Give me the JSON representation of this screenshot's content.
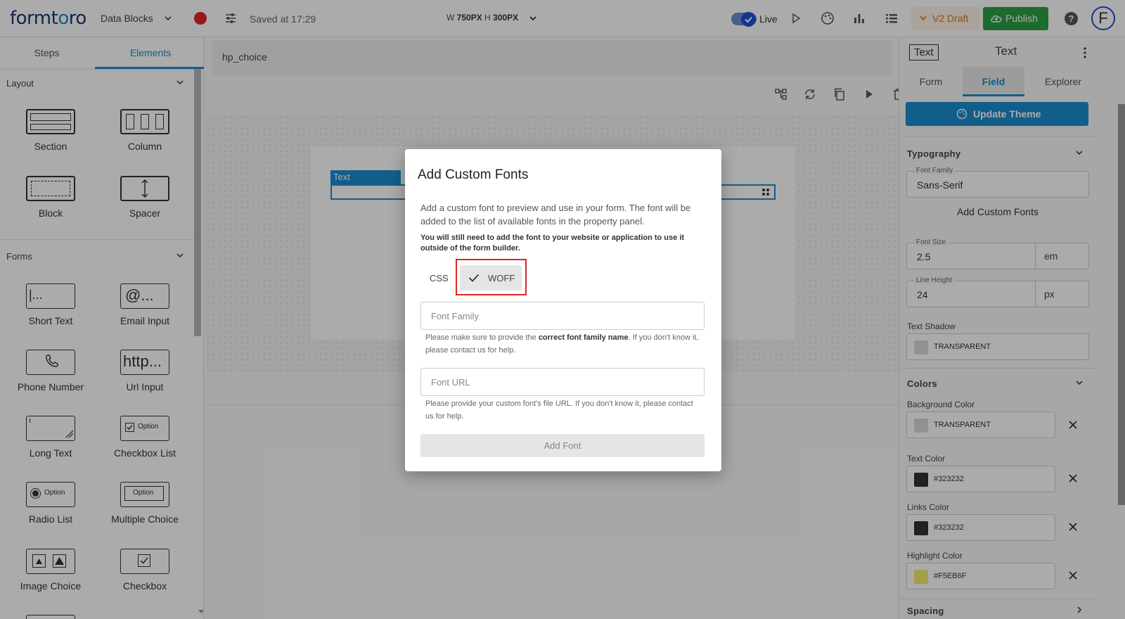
{
  "topbar": {
    "logo_a": "formt",
    "logo_b": "o",
    "logo_c": "ro",
    "project_name": "Data Blocks",
    "saved_text": "Saved at 17:29",
    "dims_w_label": "W",
    "dims_w": "750PX",
    "dims_h_label": "H",
    "dims_h": "300PX",
    "live_label": "Live",
    "draft_label": "V2 Draft",
    "publish_label": "Publish",
    "help_label": "?",
    "avatar_initial": "F"
  },
  "left": {
    "tabs": [
      "Steps",
      "Elements"
    ],
    "layout_title": "Layout",
    "forms_title": "Forms",
    "layout_items": [
      "Section",
      "Column",
      "Block",
      "Spacer"
    ],
    "form_items": [
      "Short Text",
      "Email Input",
      "Phone Number",
      "Url Input",
      "Long Text",
      "Checkbox List",
      "Radio List",
      "Multiple Choice",
      "Image Choice",
      "Checkbox"
    ],
    "icon_short_text": "|...",
    "icon_email": "@...",
    "icon_url": "http...",
    "icon_option": "Option"
  },
  "canvas": {
    "breadcrumb": "hp_choice",
    "text_tag": "Text"
  },
  "right": {
    "tag": "Text",
    "title": "Text",
    "tabs": [
      "Form",
      "Field",
      "Explorer"
    ],
    "update_theme": "Update Theme",
    "typography_title": "Typography",
    "font_family_label": "Font Family",
    "font_family_value": "Sans-Serif",
    "add_custom_fonts": "Add Custom Fonts",
    "font_size_label": "Font Size",
    "font_size_value": "2.5",
    "font_size_unit": "em",
    "line_height_label": "Line Height",
    "line_height_value": "24",
    "line_height_unit": "px",
    "text_shadow_label": "Text Shadow",
    "text_shadow_value": "TRANSPARENT",
    "colors_title": "Colors",
    "bg_color_label": "Background Color",
    "bg_color_value": "TRANSPARENT",
    "text_color_label": "Text Color",
    "text_color_value": "#323232",
    "links_color_label": "Links Color",
    "links_color_value": "#323232",
    "highlight_color_label": "Highlight Color",
    "highlight_color_value": "#F5EB6F",
    "spacing_title": "Spacing"
  },
  "modal": {
    "title": "Add Custom Fonts",
    "description": "Add a custom font to preview and use in your form. The font will be added to the list of available fonts in the property panel.",
    "note": "You will still need to add the font to your website or application to use it outside of the form builder.",
    "option_css": "CSS",
    "option_woff": "WOFF",
    "font_family_placeholder": "Font Family",
    "family_help_pre": "Please make sure to provide the ",
    "family_help_bold": "correct font family name",
    "family_help_post": ". If you don't know it, please contact us for help.",
    "font_url_placeholder": "Font URL",
    "url_help": "Please provide your custom font's file URL. If you don't know it, please contact us for help.",
    "add_button": "Add Font"
  },
  "colors": {
    "accent": "#1b8ccf",
    "publish": "#2aa047",
    "draft": "#d97a1d",
    "text_color": "#323232",
    "highlight": "#F5EB6F",
    "record": "#e02424"
  }
}
